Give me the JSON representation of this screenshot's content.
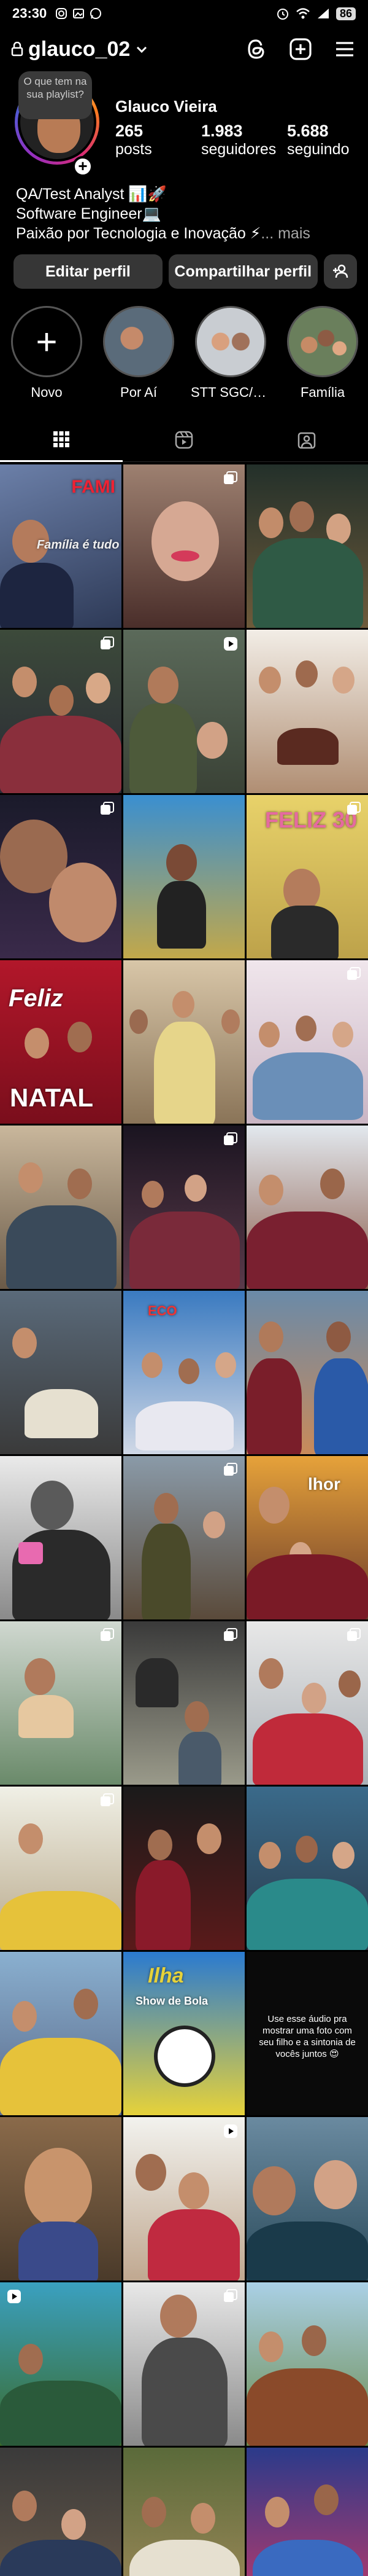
{
  "statusbar": {
    "time": "23:30",
    "battery": "86"
  },
  "header": {
    "username": "glauco_02"
  },
  "profile": {
    "note": "O que tem na sua playlist?",
    "name": "Glauco Vieira",
    "stats": [
      {
        "num": "265",
        "label": "posts"
      },
      {
        "num": "1.983",
        "label": "seguidores"
      },
      {
        "num": "5.688",
        "label": "seguindo"
      }
    ]
  },
  "bio": {
    "line1": "QA/Test Analyst 📊🚀",
    "line2": "Software Engineer💻",
    "line3": "Paixão por Tecnologia e Inovação ⚡",
    "more": "... mais"
  },
  "actions": {
    "edit": "Editar perfil",
    "share": "Compartilhar perfil"
  },
  "highlights": [
    {
      "label": "Novo"
    },
    {
      "label": "Por Aí"
    },
    {
      "label": "STT SGC/17-..."
    },
    {
      "label": "Família"
    }
  ],
  "grid": {
    "captions": {
      "c0": "FAMI",
      "c0b": "Família é tudo",
      "c8": "FELIZ 30",
      "c9a": "Feliz",
      "c9b": "NATAL",
      "c18a": "ECO",
      "c20": "lhor",
      "c34": "Show de Bola",
      "c35": "Use esse áudio pra mostrar uma foto com seu filho e a sintonia de vocês juntos 😍"
    }
  }
}
